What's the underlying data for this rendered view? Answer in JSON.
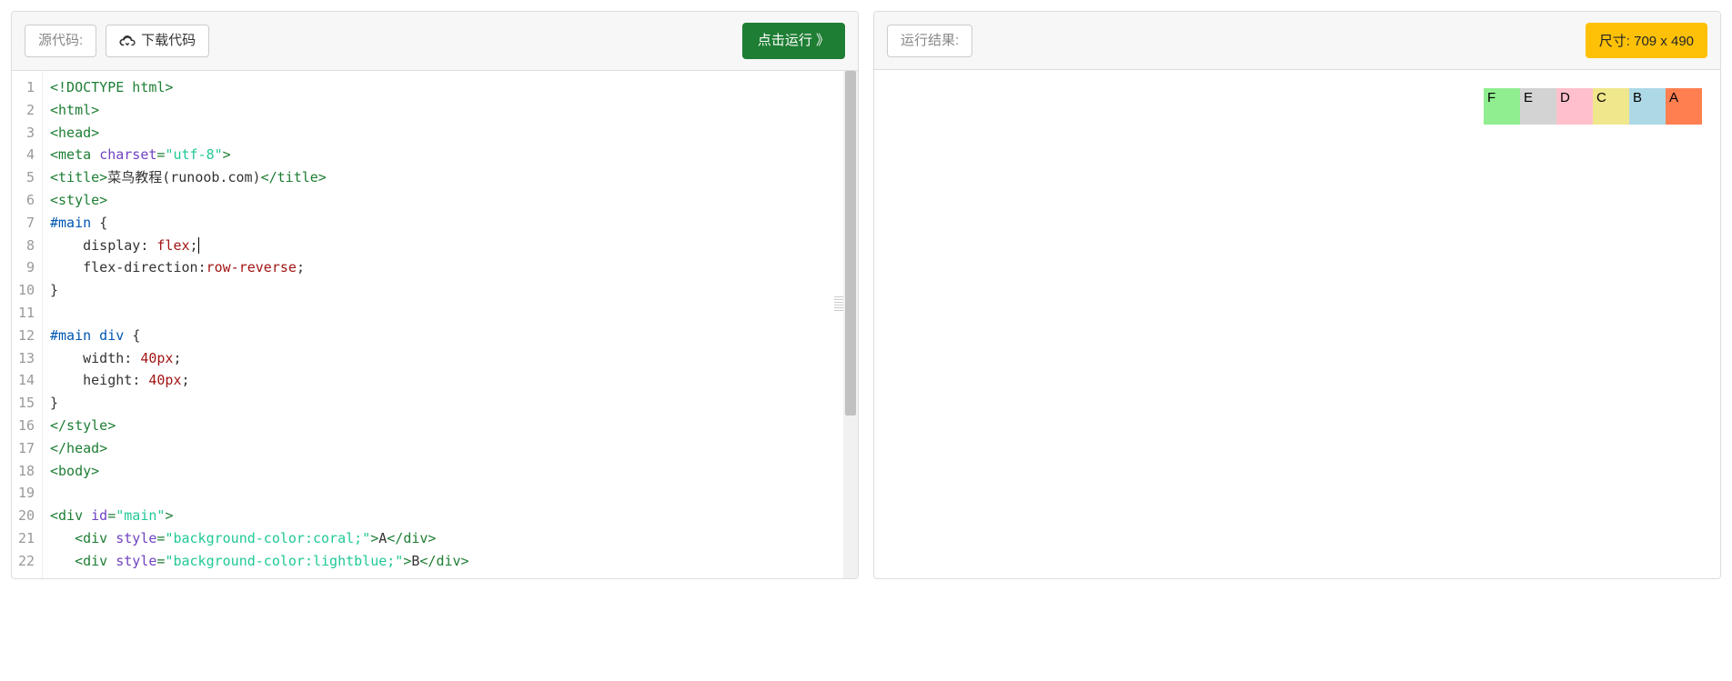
{
  "left": {
    "source_label": "源代码:",
    "download_label": "下载代码",
    "run_label": "点击运行 》"
  },
  "right": {
    "result_label": "运行结果:",
    "size_prefix": "尺寸: ",
    "size_value": "709 x 490"
  },
  "code_lines": [
    [
      {
        "t": "tag",
        "v": "<!DOCTYPE html>"
      }
    ],
    [
      {
        "t": "tag",
        "v": "<html>"
      }
    ],
    [
      {
        "t": "tag",
        "v": "<head>"
      }
    ],
    [
      {
        "t": "tag",
        "v": "<meta "
      },
      {
        "t": "attr",
        "v": "charset"
      },
      {
        "t": "tag",
        "v": "="
      },
      {
        "t": "str",
        "v": "\"utf-8\""
      },
      {
        "t": "tag",
        "v": ">"
      }
    ],
    [
      {
        "t": "tag",
        "v": "<title>"
      },
      {
        "t": "plain",
        "v": "菜鸟教程(runoob.com)"
      },
      {
        "t": "tag",
        "v": "</title>"
      }
    ],
    [
      {
        "t": "tag",
        "v": "<style>"
      }
    ],
    [
      {
        "t": "css-sel",
        "v": "#main "
      },
      {
        "t": "plain",
        "v": "{"
      }
    ],
    [
      {
        "t": "plain",
        "v": "    "
      },
      {
        "t": "css-prop",
        "v": "display"
      },
      {
        "t": "plain",
        "v": ": "
      },
      {
        "t": "css-val",
        "v": "flex"
      },
      {
        "t": "plain",
        "v": ";"
      },
      {
        "t": "caret",
        "v": ""
      }
    ],
    [
      {
        "t": "plain",
        "v": "    "
      },
      {
        "t": "css-prop",
        "v": "flex-direction"
      },
      {
        "t": "plain",
        "v": ":"
      },
      {
        "t": "css-val",
        "v": "row-reverse"
      },
      {
        "t": "plain",
        "v": ";"
      }
    ],
    [
      {
        "t": "plain",
        "v": "}"
      }
    ],
    [],
    [
      {
        "t": "css-sel",
        "v": "#main div "
      },
      {
        "t": "plain",
        "v": "{"
      }
    ],
    [
      {
        "t": "plain",
        "v": "    "
      },
      {
        "t": "css-prop",
        "v": "width"
      },
      {
        "t": "plain",
        "v": ": "
      },
      {
        "t": "css-val",
        "v": "40px"
      },
      {
        "t": "plain",
        "v": ";"
      }
    ],
    [
      {
        "t": "plain",
        "v": "    "
      },
      {
        "t": "css-prop",
        "v": "height"
      },
      {
        "t": "plain",
        "v": ": "
      },
      {
        "t": "css-val",
        "v": "40px"
      },
      {
        "t": "plain",
        "v": ";"
      }
    ],
    [
      {
        "t": "plain",
        "v": "}"
      }
    ],
    [
      {
        "t": "tag",
        "v": "</style>"
      }
    ],
    [
      {
        "t": "tag",
        "v": "</head>"
      }
    ],
    [
      {
        "t": "tag",
        "v": "<body>"
      }
    ],
    [],
    [
      {
        "t": "tag",
        "v": "<div "
      },
      {
        "t": "attr",
        "v": "id"
      },
      {
        "t": "tag",
        "v": "="
      },
      {
        "t": "str",
        "v": "\"main\""
      },
      {
        "t": "tag",
        "v": ">"
      }
    ],
    [
      {
        "t": "plain",
        "v": "   "
      },
      {
        "t": "tag",
        "v": "<div "
      },
      {
        "t": "attr",
        "v": "style"
      },
      {
        "t": "tag",
        "v": "="
      },
      {
        "t": "str",
        "v": "\"background-color:coral;\""
      },
      {
        "t": "tag",
        "v": ">"
      },
      {
        "t": "plain",
        "v": "A"
      },
      {
        "t": "tag",
        "v": "</div>"
      }
    ],
    [
      {
        "t": "plain",
        "v": "   "
      },
      {
        "t": "tag",
        "v": "<div "
      },
      {
        "t": "attr",
        "v": "style"
      },
      {
        "t": "tag",
        "v": "="
      },
      {
        "t": "str",
        "v": "\"background-color:lightblue;\""
      },
      {
        "t": "tag",
        "v": ">"
      },
      {
        "t": "plain",
        "v": "B"
      },
      {
        "t": "tag",
        "v": "</div>"
      }
    ]
  ],
  "flex_items": [
    {
      "label": "A",
      "bg": "coral"
    },
    {
      "label": "B",
      "bg": "lightblue"
    },
    {
      "label": "C",
      "bg": "khaki"
    },
    {
      "label": "D",
      "bg": "pink"
    },
    {
      "label": "E",
      "bg": "lightgrey"
    },
    {
      "label": "F",
      "bg": "lightgreen"
    }
  ]
}
